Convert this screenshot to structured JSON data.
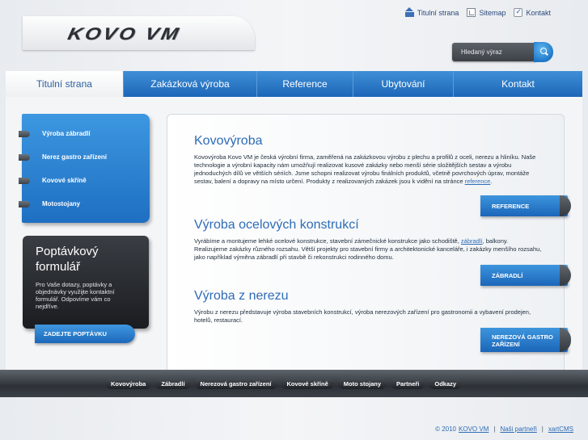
{
  "brand": {
    "logo_text": "KOVO VM"
  },
  "top_links": [
    {
      "label": "Titulní strana",
      "icon": "house-icon"
    },
    {
      "label": "Sitemap",
      "icon": "sitemap-icon"
    },
    {
      "label": "Kontakt",
      "icon": "contact-icon"
    }
  ],
  "search": {
    "placeholder": "Hledaný výraz"
  },
  "nav": [
    {
      "label": "Titulní strana",
      "active": true
    },
    {
      "label": "Zakázková výroba",
      "active": false
    },
    {
      "label": "Reference",
      "active": false
    },
    {
      "label": "Ubytování",
      "active": false
    },
    {
      "label": "Kontakt",
      "active": false
    }
  ],
  "side_menu": [
    {
      "label": "Výroba zábradlí"
    },
    {
      "label": "Nerez gastro zařízení"
    },
    {
      "label": "Kovové skříně"
    },
    {
      "label": "Motostojany"
    }
  ],
  "form_box": {
    "title": "Poptávkový formulář",
    "text": "Pro Vaše dotazy, poptávky a objednávky využijte kontaktní formulář. Odpovíme vám co nejdříve.",
    "button": "ZADEJTE POPTÁVKU"
  },
  "sections": [
    {
      "title": "Kovovýroba",
      "text": "Kovovýroba Kovo VM je česká výrobní firma, zaměřená na zakázkovou výrobu z plechu a profilů z oceli, nerezu a hliníku. Naše technologie a výrobní kapacity nám umožňují realizovat kusové zakázky nebo menší série složitějších sestav a výrobu jednoduchých dílů ve větších sériích. Jsme schopni realizovat výrobu finálních produktů, včetně povrchových úprav, montáže sestav, balení a dopravy na místo určení. Produkty z realizovaných zakázek jsou k vidění na stránce",
      "link": "reference",
      "after": ".",
      "cta": "REFERENCE"
    },
    {
      "title": "Výroba ocelových konstrukcí",
      "text": "Vyrábíme a montujeme lehké ocelové konstrukce, stavební zámečnické konstrukce jako schodiště,",
      "link": "zábradlí",
      "after": ", balkony. Realizujeme zakázky různého rozsahu. Větší projekty pro stavební firmy a architektonické kanceláře, i zakázky menšího rozsahu, jako například výměna zábradlí při stavbě či rekonstrukci rodinného domu.",
      "cta": "ZÁBRADLÍ"
    },
    {
      "title": "Výroba z nerezu",
      "text": "Výrobu z nerezu představuje výroba stavebních konstrukcí, výroba nerezových zařízení pro gastronomii a vybavení prodejen, hotelů, restaurací.",
      "link": "",
      "after": "",
      "cta": "NEREZOVÁ GASTRO ZAŘÍZENÍ"
    }
  ],
  "footer_nav": [
    "Kovovýroba",
    "Zábradlí",
    "Nerezová gastro zařízení",
    "Kovové skříně",
    "Moto stojany",
    "Partneři",
    "Odkazy"
  ],
  "copyright": {
    "prefix": "© 2010",
    "company": "KOVO VM",
    "partners": "Naši partneři",
    "cms": "xartCMS",
    "separator": "|"
  },
  "colors": {
    "accent": "#2e6cb6",
    "nav_blue": "#1c66b8",
    "dark": "#2d3137"
  }
}
